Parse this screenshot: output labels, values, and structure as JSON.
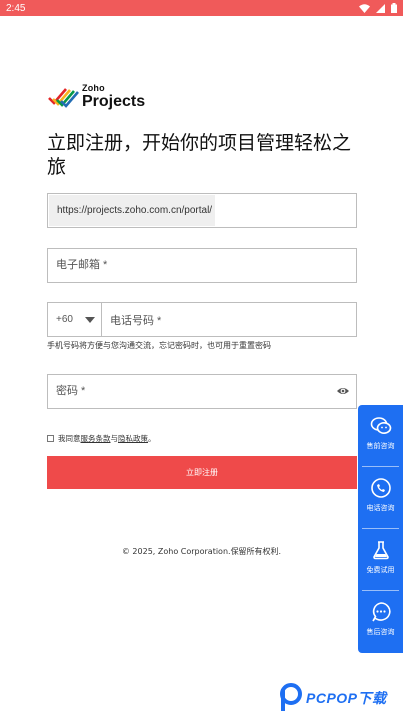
{
  "status_bar": {
    "time": "2:45"
  },
  "logo": {
    "line1": "Zoho",
    "line2": "Projects"
  },
  "headline": "立即注册，开始你的项目管理轻松之旅",
  "form": {
    "portal_prefix": "https://projects.zoho.com.cn/portal/",
    "email_placeholder": "电子邮箱 *",
    "phone_code": "+60",
    "phone_placeholder": "电话号码 *",
    "phone_hint": "手机号码将方便与您沟通交流，忘记密码时，也可用于重置密码",
    "password_placeholder": "密码 *",
    "agree_prefix": "我同意",
    "terms_link": "服务条款",
    "agree_and": "与",
    "privacy_link": "隐私政策",
    "agree_suffix": "。",
    "register_button": "立即注册"
  },
  "footer": "© 2025, Zoho Corporation.保留所有权利.",
  "side_panel": {
    "items": [
      {
        "label": "售前咨询",
        "icon": "wechat-icon"
      },
      {
        "label": "电话咨询",
        "icon": "phone-icon"
      },
      {
        "label": "免费试用",
        "icon": "flask-icon"
      },
      {
        "label": "售后咨询",
        "icon": "chat-bubble-icon"
      }
    ]
  },
  "watermark": {
    "text": "PCPOP下载"
  },
  "colors": {
    "accent_red": "#ef4a4a",
    "status_bar": "#f05a5a",
    "panel_blue": "#1e6ff2"
  }
}
